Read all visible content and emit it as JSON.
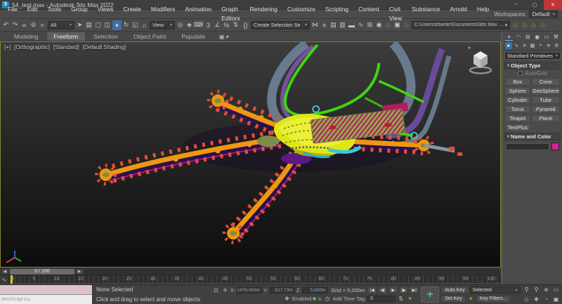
{
  "window": {
    "title": "54_test.max - Autodesk 3ds Max 2022",
    "app_badge": "3",
    "minimize": "─",
    "restore": "▢",
    "close": "✕",
    "workspaces_label": "Workspaces:",
    "workspace_value": "Default"
  },
  "menubar": {
    "items": [
      "File",
      "Edit",
      "Tools",
      "Group",
      "Views",
      "Create",
      "Modifiers",
      "Animation",
      "Graph Editors",
      "Rendering",
      "Customize",
      "Scripting",
      "Content",
      "Civil View",
      "Substance",
      "Arnold",
      "Help"
    ]
  },
  "toolbar": {
    "selection_filter": "All",
    "coord_system": "View",
    "named_sets": "Create Selection Se",
    "project_path": "C:\\Users\\trbarter\\Documents\\3ds Max 2022",
    "seg_a": [
      {
        "name": "undo-icon",
        "glyph": "↶"
      },
      {
        "name": "redo-icon",
        "glyph": "↷"
      },
      {
        "name": "select-and-link-icon",
        "glyph": "∞"
      },
      {
        "name": "unlink-selection-icon",
        "glyph": "⊘"
      },
      {
        "name": "bind-to-space-warp-icon",
        "glyph": "≈"
      }
    ],
    "seg_b": [
      {
        "name": "select-object-icon",
        "glyph": "➤"
      },
      {
        "name": "select-by-name-icon",
        "glyph": "▤"
      },
      {
        "name": "selection-region-icon",
        "glyph": "▢"
      },
      {
        "name": "window-crossing-icon",
        "glyph": "◫"
      }
    ],
    "seg_c": [
      {
        "name": "select-and-move-icon",
        "glyph": "+",
        "active": true
      },
      {
        "name": "select-and-rotate-icon",
        "glyph": "↻"
      },
      {
        "name": "select-and-scale-icon",
        "glyph": "◱"
      },
      {
        "name": "select-and-place-icon",
        "glyph": "⌂"
      }
    ],
    "seg_d": [
      {
        "name": "use-pivot-center-icon",
        "glyph": "◎"
      },
      {
        "name": "select-and-manipulate-icon",
        "glyph": "◈"
      },
      {
        "name": "keyboard-override-icon",
        "glyph": "⌨"
      }
    ],
    "seg_e": [
      {
        "name": "snaps-toggle-icon",
        "glyph": "3"
      },
      {
        "name": "angle-snap-icon",
        "glyph": "∠"
      },
      {
        "name": "percent-snap-icon",
        "glyph": "%"
      },
      {
        "name": "spinner-snap-icon",
        "glyph": "⇅"
      }
    ],
    "seg_f": [
      {
        "name": "named-selection-sets-icon",
        "glyph": "{}"
      }
    ],
    "seg_g": [
      {
        "name": "mirror-icon",
        "glyph": "⋈"
      },
      {
        "name": "align-icon",
        "glyph": "≡"
      },
      {
        "name": "scene-explorer-icon",
        "glyph": "▤"
      },
      {
        "name": "layer-explorer-icon",
        "glyph": "▥"
      },
      {
        "name": "ribbon-toggle-icon",
        "glyph": "▬"
      },
      {
        "name": "curve-editor-icon",
        "glyph": "∿"
      },
      {
        "name": "schematic-view-icon",
        "glyph": "⊞"
      },
      {
        "name": "material-editor-icon",
        "glyph": "◉"
      },
      {
        "name": "render-setup-icon",
        "glyph": "♨",
        "cls": "gold"
      },
      {
        "name": "rendered-frame-icon",
        "glyph": "▣"
      },
      {
        "name": "render-production-icon",
        "glyph": "♨",
        "cls": "gold"
      }
    ],
    "seg_h": [
      {
        "name": "render-teapot-1-icon",
        "glyph": "♨",
        "cls": "gold"
      },
      {
        "name": "render-teapot-2-icon",
        "glyph": "♨",
        "cls": "gold"
      },
      {
        "name": "render-teapot-3-icon",
        "glyph": "♨",
        "cls": "gold"
      },
      {
        "name": "render-teapot-4-icon",
        "glyph": "♨",
        "cls": "gold"
      }
    ]
  },
  "ribbon": {
    "tabs": [
      {
        "name": "tab-modeling",
        "label": "Modeling"
      },
      {
        "name": "tab-freeform",
        "label": "Freeform",
        "active": true
      },
      {
        "name": "tab-selection",
        "label": "Selection"
      },
      {
        "name": "tab-object-paint",
        "label": "Object Paint"
      },
      {
        "name": "tab-populate",
        "label": "Populate"
      }
    ],
    "config_glyph": "▣ ▾"
  },
  "viewport": {
    "label_menu": "[+]",
    "label_pov": "[Orthographic]",
    "label_style": "[Standard]",
    "label_shading": "[Default Shading]"
  },
  "command_panel": {
    "tabs": [
      {
        "name": "create-tab",
        "glyph": "+",
        "active": true
      },
      {
        "name": "modify-tab",
        "glyph": "◠"
      },
      {
        "name": "hierarchy-tab",
        "glyph": "⊟"
      },
      {
        "name": "motion-tab",
        "glyph": "◉"
      },
      {
        "name": "display-tab",
        "glyph": "▭"
      },
      {
        "name": "utilities-tab",
        "glyph": "⚒"
      }
    ],
    "categories": [
      {
        "name": "geometry-category",
        "glyph": "●",
        "active": true
      },
      {
        "name": "shapes-category",
        "glyph": "∿"
      },
      {
        "name": "lights-category",
        "glyph": "☀"
      },
      {
        "name": "cameras-category",
        "glyph": "▦"
      },
      {
        "name": "helpers-category",
        "glyph": "⌖"
      },
      {
        "name": "spacewarps-category",
        "glyph": "≋"
      },
      {
        "name": "systems-category",
        "glyph": "⚙"
      }
    ],
    "dropdown_value": "Standard Primitives",
    "rollout_object_type": "Object Type",
    "autogrid_label": "AutoGrid",
    "object_buttons": [
      "Box",
      "Cone",
      "Sphere",
      "GeoSphere",
      "Cylinder",
      "Tube",
      "Torus",
      "Pyramid",
      "Teapot",
      "Plane",
      "TextPlus"
    ],
    "rollout_name_color": "Name and Color",
    "swatch_color": "#d6219c"
  },
  "timeline": {
    "slider_value": "0 / 100",
    "prev_glyph": "◀",
    "next_glyph": "▶",
    "mini_curve_glyph": "∿",
    "ticks": [
      "0",
      "5",
      "10",
      "15",
      "20",
      "25",
      "30",
      "35",
      "40",
      "45",
      "50",
      "55",
      "60",
      "65",
      "70",
      "75",
      "80",
      "85",
      "90",
      "95",
      "100"
    ]
  },
  "statusbar": {
    "listener_text": "MAXScript Lis",
    "status": "None Selected",
    "prompt": "Click and drag to select and move objects",
    "lock_glyph": "⊡",
    "abs_glyph": "✛",
    "x_label": "X:",
    "x_value": "-1476.043m",
    "y_label": "Y:",
    "y_value": "-517.73m",
    "z_label": "Z:",
    "z_value": "5,000m",
    "grid_label": "Grid = 5,000m",
    "welcome_glyph": "❖",
    "enabled_label": "Enabled",
    "timetag_glyph": "◷",
    "add_time_tag": "Add Time Tag",
    "playback": [
      {
        "name": "go-to-start-button",
        "glyph": "|◀"
      },
      {
        "name": "previous-frame-button",
        "glyph": "◀|"
      },
      {
        "name": "play-button",
        "glyph": "▶"
      },
      {
        "name": "next-frame-button",
        "glyph": "|▶"
      },
      {
        "name": "go-to-end-button",
        "glyph": "▶|"
      }
    ],
    "frame_value": "0",
    "spinner_glyph": "⇅",
    "keymode_glyph": "✦",
    "setkeys_glyph": "+",
    "auto_key": "Auto Key",
    "set_key": "Set Key",
    "selected_value": "Selected",
    "keyfilter_icon_glyph": "✦",
    "key_filters": "Key Filters...",
    "nav_row1": [
      {
        "name": "zoom-icon",
        "glyph": "⚲"
      },
      {
        "name": "zoom-all-icon",
        "glyph": "⚲"
      },
      {
        "name": "zoom-extents-icon",
        "glyph": "⧈"
      },
      {
        "name": "zoom-region-icon",
        "glyph": "▭"
      }
    ],
    "nav_row2": [
      {
        "name": "fov-icon",
        "glyph": "◇"
      },
      {
        "name": "pan-icon",
        "glyph": "✥"
      },
      {
        "name": "orbit-icon",
        "glyph": "◔"
      },
      {
        "name": "maximize-viewport-icon",
        "glyph": "▣"
      }
    ]
  },
  "colors": {
    "accent_blue": "#3f6fa8",
    "close_red": "#c13535",
    "viewport_border": "#8a8435",
    "model_orange": "#ef9710",
    "model_red": "#e45038",
    "model_yellow": "#dfe616",
    "model_green": "#3fd60e",
    "model_cyan": "#38c8d8",
    "model_purple": "#5a1a86"
  }
}
